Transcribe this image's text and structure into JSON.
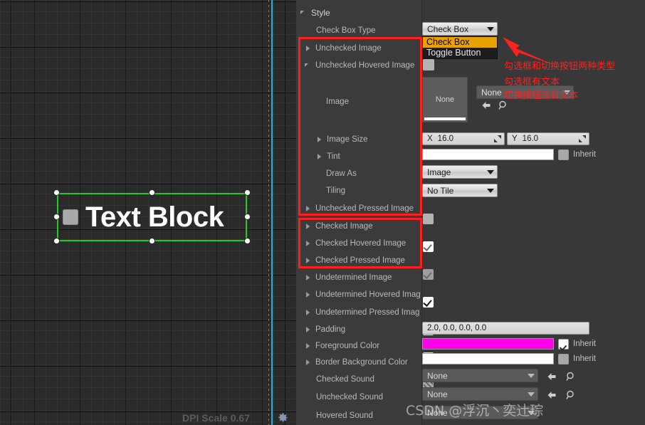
{
  "canvas": {
    "widget_label": "Text Block",
    "dpi_scale": "DPI Scale 0.67",
    "gear_icon": "gear-icon"
  },
  "panel": {
    "section_header": "Style",
    "rows": [
      {
        "label": "Check Box Type",
        "arrow": "none",
        "indent": 2
      },
      {
        "label": "Unchecked Image",
        "arrow": "right",
        "indent": 1
      },
      {
        "label": "Unchecked Hovered Image",
        "arrow": "down",
        "indent": 1
      },
      {
        "label": "Image",
        "arrow": "none",
        "indent": 3
      },
      {
        "label": "Image Size",
        "arrow": "right",
        "indent": 2
      },
      {
        "label": "Tint",
        "arrow": "right",
        "indent": 2
      },
      {
        "label": "Draw As",
        "arrow": "none",
        "indent": 3
      },
      {
        "label": "Tiling",
        "arrow": "none",
        "indent": 3
      },
      {
        "label": "Unchecked Pressed Image",
        "arrow": "right",
        "indent": 1
      },
      {
        "label": "Checked Image",
        "arrow": "right",
        "indent": 1
      },
      {
        "label": "Checked Hovered Image",
        "arrow": "right",
        "indent": 1
      },
      {
        "label": "Checked Pressed Image",
        "arrow": "right",
        "indent": 1
      },
      {
        "label": "Undetermined Image",
        "arrow": "right",
        "indent": 1
      },
      {
        "label": "Undetermined Hovered Imag",
        "arrow": "right",
        "indent": 1
      },
      {
        "label": "Undetermined Pressed Imag",
        "arrow": "right",
        "indent": 1
      },
      {
        "label": "Padding",
        "arrow": "right",
        "indent": 1
      },
      {
        "label": "Foreground Color",
        "arrow": "right",
        "indent": 1
      },
      {
        "label": "Border Background Color",
        "arrow": "right",
        "indent": 1
      },
      {
        "label": "Checked Sound",
        "arrow": "none",
        "indent": 2
      },
      {
        "label": "Unchecked Sound",
        "arrow": "none",
        "indent": 2
      },
      {
        "label": "Hovered Sound",
        "arrow": "none",
        "indent": 2
      }
    ],
    "check_box_type": {
      "selected": "Check Box",
      "options": [
        "Check Box",
        "Toggle Button"
      ],
      "highlighted": "Check Box"
    },
    "unchecked_image_preview": "unchecked",
    "thumbnail_label": "None",
    "asset_picker_value": "None",
    "back_icon": "back-arrow-icon",
    "browse_icon": "magnifier-icon",
    "image_size": {
      "x_key": "X",
      "x_value": "16.0",
      "y_key": "Y",
      "y_value": "16.0"
    },
    "tint": {
      "color": "#ffffff",
      "inherit_label": "Inherit",
      "inherit_checked": false
    },
    "draw_as": "Image",
    "tiling": "No Tile",
    "padding": "2.0, 0.0, 0.0, 0.0",
    "foreground_color": {
      "color": "#ff00e8",
      "inherit_label": "Inherit",
      "inherit_checked": true
    },
    "border_background_color": {
      "color": "#ffffff",
      "inherit_label": "Inherit",
      "inherit_checked": false
    },
    "sounds": {
      "checked": "None",
      "unchecked": "None",
      "hovered": "None"
    }
  },
  "annotations": {
    "line1": "勾选框和切换按钮两种类型",
    "line2": "勾选框有文本",
    "line3": "切换按钮没有文本",
    "arrow": "red-arrow-icon",
    "box1_name": "unchecked-states-highlight",
    "box2_name": "checked-states-highlight"
  },
  "watermark": "CSDN @浮沉丶奕辻琮",
  "colors": {
    "selection_green": "#19d119",
    "guide_cyan": "#19b5e0",
    "annotation_red": "#ff2020",
    "dropdown_highlight": "#e8a200",
    "foreground_magenta": "#ff00e8"
  }
}
